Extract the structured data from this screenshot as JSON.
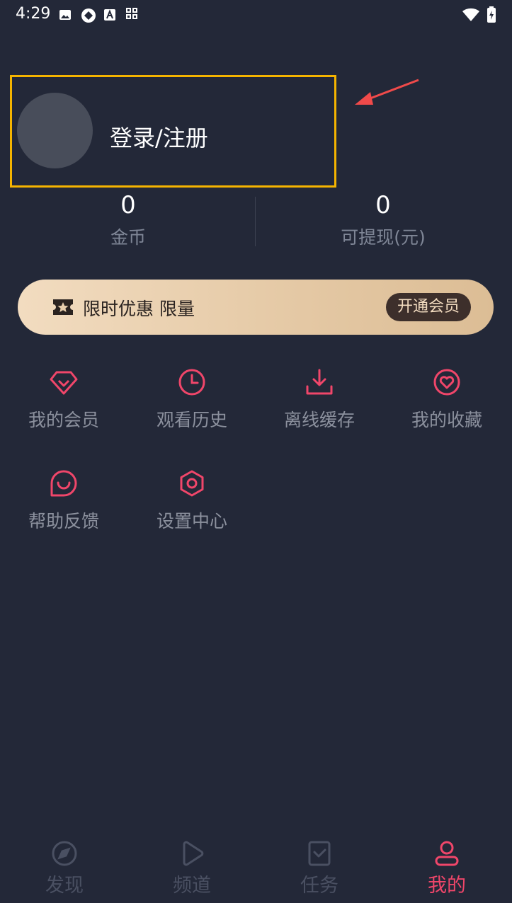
{
  "status_bar": {
    "time": "4:29"
  },
  "profile": {
    "login_label": "登录/注册"
  },
  "stats": {
    "coins_value": "0",
    "coins_label": "金币",
    "cash_value": "0",
    "cash_label": "可提现(元)"
  },
  "vip_banner": {
    "text": "限时优惠 限量",
    "button_label": "开通会员"
  },
  "menu": {
    "items": [
      {
        "label": "我的会员",
        "icon": "diamond-icon"
      },
      {
        "label": "观看历史",
        "icon": "clock-icon"
      },
      {
        "label": "离线缓存",
        "icon": "download-icon"
      },
      {
        "label": "我的收藏",
        "icon": "heart-icon"
      },
      {
        "label": "帮助反馈",
        "icon": "smile-chat-icon"
      },
      {
        "label": "设置中心",
        "icon": "settings-icon"
      }
    ]
  },
  "bottom_nav": {
    "items": [
      {
        "label": "发现",
        "icon": "compass-icon"
      },
      {
        "label": "频道",
        "icon": "play-icon"
      },
      {
        "label": "任务",
        "icon": "task-icon"
      },
      {
        "label": "我的",
        "icon": "user-icon"
      }
    ],
    "active_index": 3
  },
  "colors": {
    "background": "#232838",
    "accent": "#f0466a",
    "highlight_box": "#f5b400",
    "vip_gradient_start": "#f2dcc0",
    "vip_gradient_end": "#dcbd95"
  }
}
